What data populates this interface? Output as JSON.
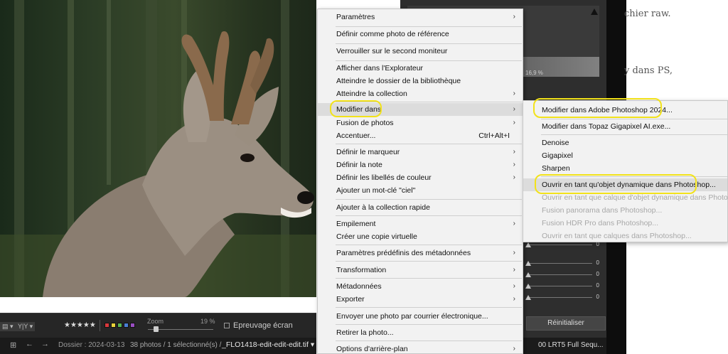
{
  "article": {
    "line1": "chier raw.",
    "line2": "y dans PS,"
  },
  "lightroom": {
    "histogram_pct": "16,9 %",
    "slider_values": [
      "0",
      "0",
      "0",
      "0",
      "0"
    ],
    "reset_label": "Réinitialiser",
    "toolbar": {
      "rating": "★★★★★",
      "zoom_label": "Zoom",
      "zoom_value": "19 %",
      "proof_label": "Epreuvage écran",
      "view_a": "▤ ▾",
      "view_b": "Y|Y ▾"
    },
    "status": {
      "folder": "Dossier : 2024-03-13",
      "count": "38 photos / 1 sélectionné(s) /",
      "filename": "_FLO1418-edit-edit-edit.tif ▾",
      "profile": "00 LRT5 Full Sequ..."
    },
    "colors": {
      "label_colors": [
        "#d9393d",
        "#e8d23a",
        "#58b651",
        "#4a7fd6",
        "#9a4fc2"
      ]
    }
  },
  "context_menu": {
    "items": [
      {
        "label": "Paramètres",
        "submenu": true
      },
      {
        "label": "Définir comme photo de référence"
      },
      {
        "label": "Verrouiller sur le second moniteur"
      },
      {
        "label": "Afficher dans l'Explorateur"
      },
      {
        "label": "Atteindre le dossier de la bibliothèque"
      },
      {
        "label": "Atteindre la collection",
        "submenu": true
      },
      {
        "label": "Modifier dans",
        "submenu": true
      },
      {
        "label": "Fusion de photos",
        "submenu": true
      },
      {
        "label": "Accentuer...",
        "shortcut": "Ctrl+Alt+I"
      },
      {
        "label": "Définir le marqueur",
        "submenu": true
      },
      {
        "label": "Définir la note",
        "submenu": true
      },
      {
        "label": "Définir les libellés de couleur",
        "submenu": true
      },
      {
        "label": "Ajouter un mot-clé \"ciel\""
      },
      {
        "label": "Ajouter à la collection rapide"
      },
      {
        "label": "Empilement",
        "submenu": true
      },
      {
        "label": "Créer une copie virtuelle"
      },
      {
        "label": "Paramètres prédéfinis des métadonnées",
        "submenu": true
      },
      {
        "label": "Transformation",
        "submenu": true
      },
      {
        "label": "Métadonnées",
        "submenu": true
      },
      {
        "label": "Exporter",
        "submenu": true
      },
      {
        "label": "Envoyer une photo par courrier électronique..."
      },
      {
        "label": "Retirer la photo..."
      },
      {
        "label": "Options d'arrière-plan",
        "submenu": true
      }
    ],
    "arrow": "›"
  },
  "submenu": {
    "items": [
      {
        "label": "Modifier dans Adobe Photoshop 2024...",
        "enabled": true
      },
      {
        "label": "Modifier dans Topaz Gigapixel AI.exe...",
        "enabled": true
      },
      {
        "label": "Denoise",
        "enabled": true
      },
      {
        "label": "Gigapixel",
        "enabled": true
      },
      {
        "label": "Sharpen",
        "enabled": true
      },
      {
        "label": "Ouvrir en tant qu'objet dynamique dans Photoshop...",
        "enabled": true
      },
      {
        "label": "Ouvrir en tant que calque d'objet dynamique dans Photoshop...",
        "enabled": false
      },
      {
        "label": "Fusion panorama dans Photoshop...",
        "enabled": false
      },
      {
        "label": "Fusion HDR Pro dans Photoshop...",
        "enabled": false
      },
      {
        "label": "Ouvrir en tant que calques dans Photoshop...",
        "enabled": false
      }
    ]
  },
  "annotations": {
    "highlight_color": "#f2e21a"
  }
}
